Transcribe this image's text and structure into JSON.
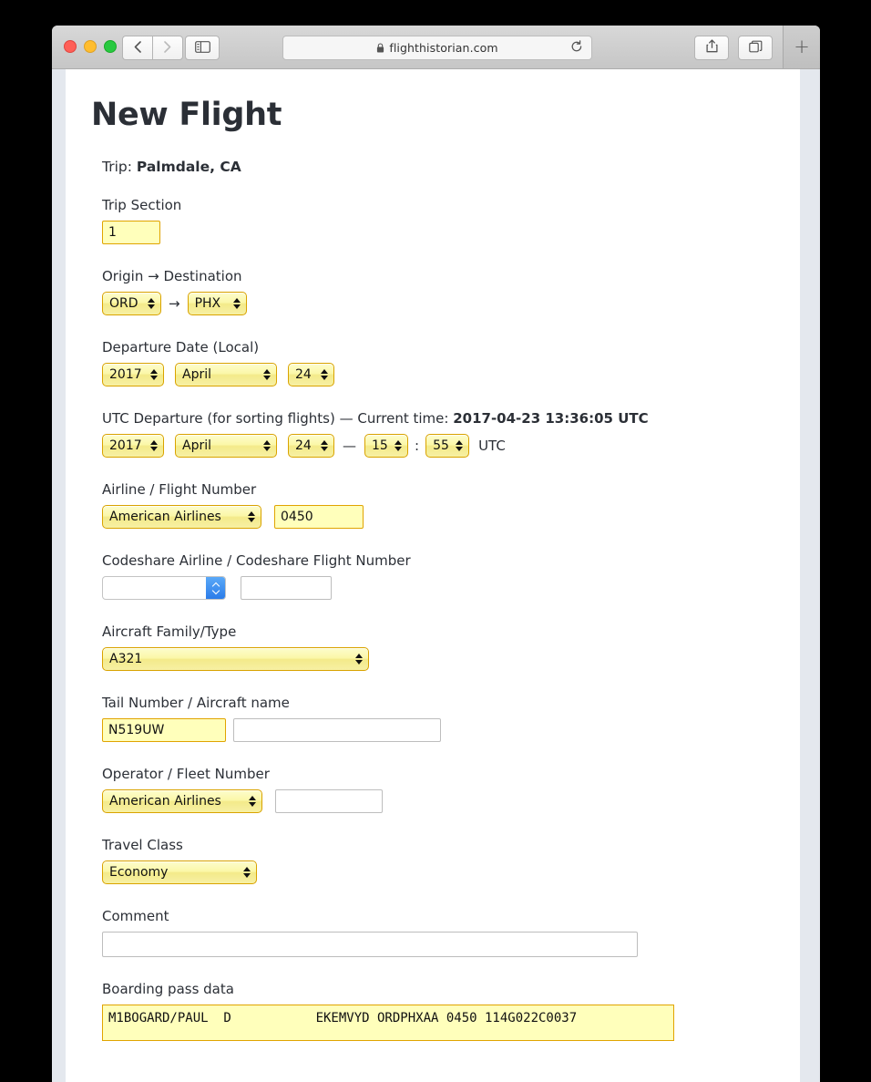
{
  "browser": {
    "url": "flighthistorian.com",
    "lock_icon": "lock-icon",
    "reload_icon": "reload-icon",
    "back_icon": "back-chevron-icon",
    "forward_icon": "forward-chevron-icon",
    "sidebar_icon": "sidebar-icon",
    "share_icon": "share-icon",
    "tabs_icon": "tab-overview-icon",
    "new_tab_label": "+"
  },
  "page": {
    "title": "New Flight",
    "trip_prefix": "Trip:",
    "trip_name": "Palmdale, CA",
    "fields": {
      "trip_section": {
        "label": "Trip Section",
        "value": "1"
      },
      "route": {
        "label": "Origin → Destination",
        "origin": "ORD",
        "arrow": "→",
        "destination": "PHX"
      },
      "departure_date": {
        "label": "Departure Date (Local)",
        "year": "2017",
        "month": "April",
        "day": "24"
      },
      "utc_departure": {
        "label_main": "UTC Departure (for sorting flights) — Current time:",
        "current_time": "2017-04-23 13:36:05 UTC",
        "year": "2017",
        "month": "April",
        "day": "24",
        "dash": "—",
        "hour": "15",
        "colon": ":",
        "minute": "55",
        "unit": "UTC"
      },
      "airline": {
        "label": "Airline / Flight Number",
        "airline": "American Airlines",
        "flight_number": "0450"
      },
      "codeshare": {
        "label": "Codeshare Airline / Codeshare Flight Number",
        "airline": "",
        "flight_number": ""
      },
      "aircraft": {
        "label": "Aircraft Family/Type",
        "value": "A321"
      },
      "tail": {
        "label": "Tail Number / Aircraft name",
        "tail_number": "N519UW",
        "aircraft_name": ""
      },
      "operator": {
        "label": "Operator / Fleet Number",
        "operator": "American Airlines",
        "fleet_number": ""
      },
      "travel_class": {
        "label": "Travel Class",
        "value": "Economy"
      },
      "comment": {
        "label": "Comment",
        "value": ""
      },
      "boarding_pass": {
        "label": "Boarding pass data",
        "value": "M1BOGARD/PAUL  D           EKEMVYD ORDPHXAA 0450 114G022C0037"
      }
    }
  },
  "colors": {
    "autofill_bg": "#ffffbb",
    "autofill_border": "#e0a400",
    "select_border": "#d9a300",
    "stepper_blue": "#2b7ce9",
    "page_gutter": "#e4e8ee"
  }
}
